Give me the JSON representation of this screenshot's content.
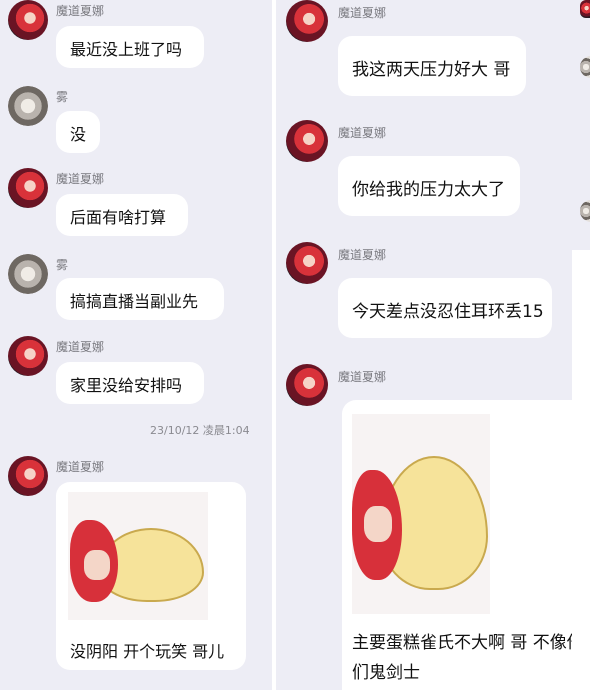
{
  "left": {
    "messages": [
      {
        "sender": "魔道夏娜",
        "text": "最近没上班了吗"
      },
      {
        "sender": "雾",
        "text": "没"
      },
      {
        "sender": "魔道夏娜",
        "text": "后面有啥打算"
      },
      {
        "sender": "雾",
        "text": "搞搞直播当副业先"
      },
      {
        "sender": "魔道夏娜",
        "text": "家里没给安排吗"
      }
    ],
    "timestamp": "23/10/12 凌晨1:04",
    "sticker_message": {
      "sender": "魔道夏娜",
      "caption": "没阴阳 开个玩笑 哥儿"
    }
  },
  "mid": {
    "messages": [
      {
        "sender": "魔道夏娜",
        "text": "我这两天压力好大 哥"
      },
      {
        "sender": "魔道夏娜",
        "text": "你给我的压力太大了"
      },
      {
        "sender": "魔道夏娜",
        "text": "今天差点没忍住耳环丢15"
      }
    ],
    "sticker_message": {
      "sender": "魔道夏娜",
      "caption_line1": "主要蛋糕雀氏不大啊 哥  不像他",
      "caption_line2": "们鬼剑士"
    }
  },
  "colors": {
    "background": "#ededf5",
    "bubble": "#ffffff",
    "name": "#7a7a80"
  },
  "icons": {
    "avatar_shana": "red-haired-anime-avatar",
    "avatar_wu": "cat-avatar"
  }
}
